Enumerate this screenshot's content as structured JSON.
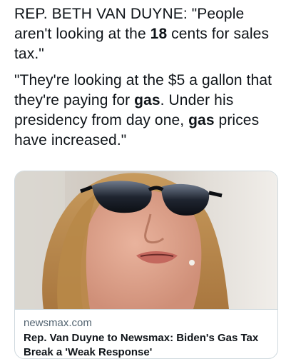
{
  "tweet": {
    "paragraph1": {
      "part1": "REP. BETH VAN DUYNE: \"People aren't looking at the ",
      "bold1": "18",
      "part2": " cents for sales tax.\""
    },
    "paragraph2": {
      "part1": "\"They're looking at the $5 a gallon that they're paying for ",
      "bold1": "gas",
      "part2": ". Under his presidency from day one, ",
      "bold2": "gas",
      "part3": " prices have increased.\""
    }
  },
  "card": {
    "domain": "newsmax.com",
    "title": "Rep. Van Duyne to Newsmax: Biden's Gas Tax Break a 'Weak Response'"
  }
}
